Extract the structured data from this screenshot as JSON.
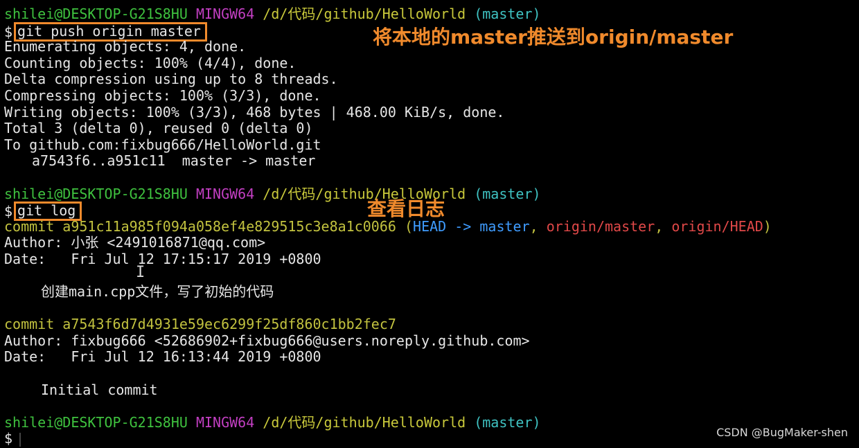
{
  "prompt": {
    "user_host": "shilei@DESKTOP-G21S8HU",
    "shell": "MINGW64",
    "path": "/d/代码/github/HelloWorld",
    "branch": "(master)",
    "symbol": "$"
  },
  "cmd1": "git push origin master",
  "push_output": [
    "Enumerating objects: 4, done.",
    "Counting objects: 100% (4/4), done.",
    "Delta compression using up to 8 threads.",
    "Compressing objects: 100% (3/3), done.",
    "Writing objects: 100% (3/3), 468 bytes | 468.00 KiB/s, done.",
    "Total 3 (delta 0), reused 0 (delta 0)",
    "To github.com:fixbug666/HelloWorld.git",
    "a7543f6..a951c11  master -> master"
  ],
  "cmd2": "git log",
  "commit1": {
    "label": "commit a951c11a985f094a058ef4e829515c3e8a1c0066",
    "ref_open": "(",
    "head": "HEAD -> master",
    "sep1": ", ",
    "origin_master": "origin/master",
    "sep2": ", ",
    "origin_head": "origin/HEAD",
    "ref_close": ")",
    "author": "Author: 小张 <2491016871@qq.com>",
    "date": "Date:   Fri Jul 12 17:15:17 2019 +0800",
    "message": "创建main.cpp文件，写了初始的代码"
  },
  "commit2": {
    "label": "commit a7543f6d7d4931e59ec6299f25df860c1bb2fec7",
    "author": "Author: fixbug666 <52686902+fixbug666@users.noreply.github.com>",
    "date": "Date:   Fri Jul 12 16:13:44 2019 +0800",
    "message": "Initial commit"
  },
  "annotations": {
    "push": "将本地的master推送到origin/master",
    "log": "查看日志"
  },
  "watermark": "CSDN @BugMaker-shen",
  "ibeam": "I",
  "colors": {
    "annotation": "#f08a2c",
    "prompt_user": "#3fc23f",
    "prompt_shell": "#c23fc2",
    "prompt_path": "#c9c93b",
    "prompt_branch": "#3fc2c2"
  }
}
